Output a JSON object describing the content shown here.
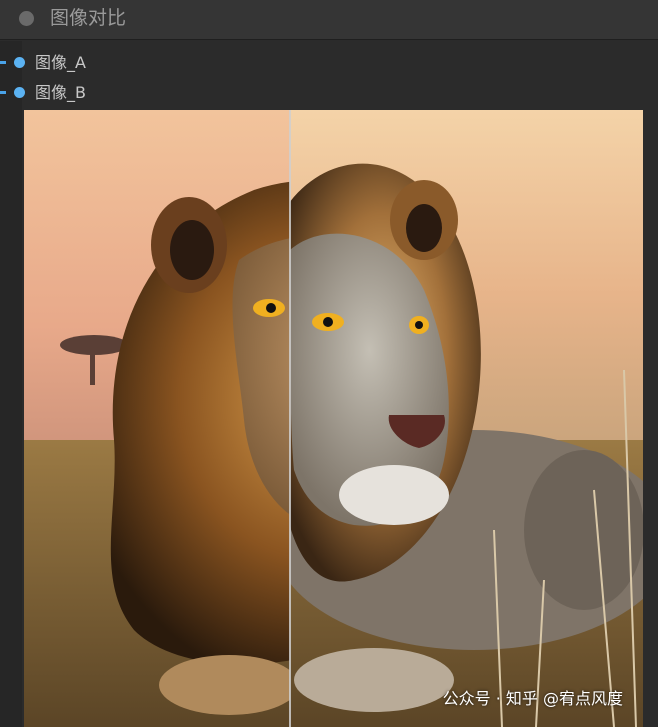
{
  "node": {
    "title": "图像对比"
  },
  "inputs": [
    {
      "label": "图像_A"
    },
    {
      "label": "图像_B"
    }
  ],
  "colors": {
    "port": "#5bb2f2",
    "title_text": "#9a9a9a",
    "background": "#2b2b2b"
  },
  "compare": {
    "split_fraction": 0.43
  },
  "watermark": "公众号 · 知乎 @宥点风度"
}
